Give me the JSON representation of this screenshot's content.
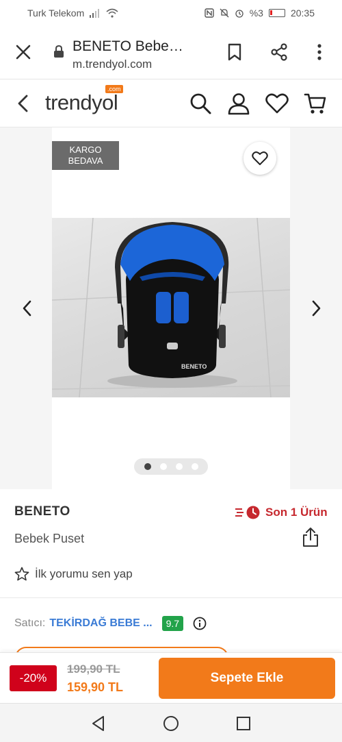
{
  "status_bar": {
    "carrier": "Turk Telekom",
    "battery": "%3",
    "time": "20:35"
  },
  "browser": {
    "page_title": "BENETO Bebe…",
    "url": "m.trendyol.com"
  },
  "site": {
    "logo_text": "trendyol",
    "logo_badge": ".com"
  },
  "gallery": {
    "badge_line1": "KARGO",
    "badge_line2": "BEDAVA",
    "image_count": 4,
    "active_index": 0,
    "image_text": "BENETO"
  },
  "product": {
    "brand": "BENETO",
    "name": "Bebek Puset",
    "stock_text": "Son 1 Ürün",
    "review_prompt": "İlk yorumu sen yap"
  },
  "seller": {
    "label": "Satıcı:",
    "name": "TEKİRDAĞ BEBE ...",
    "score": "9.7"
  },
  "purchase": {
    "discount": "-20%",
    "old_price": "199,90 TL",
    "new_price": "159,90 TL",
    "cart_button": "Sepete Ekle"
  },
  "colors": {
    "accent": "#f27a1a",
    "stock_red": "#c6282e",
    "discount_red": "#d0021b",
    "score_green": "#22a34a",
    "seller_blue": "#3a7bd5"
  }
}
